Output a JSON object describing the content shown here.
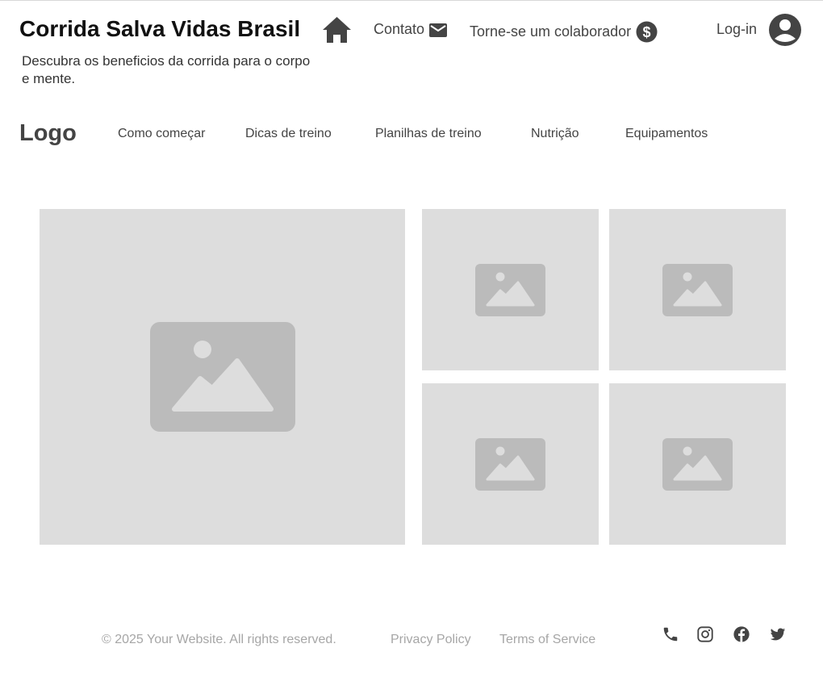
{
  "header": {
    "site_title": "Corrida Salva Vidas Brasil",
    "tagline": "Descubra os beneficios da corrida para o corpo e mente.",
    "home_icon": "home-icon",
    "links": {
      "contact": "Contato",
      "contributor": "Torne-se um colaborador"
    },
    "login": "Log-in"
  },
  "nav": {
    "logo": "Logo",
    "items": [
      "Como começar",
      "Dicas de treino",
      "Planilhas de treino",
      "Nutrição",
      "Equipamentos"
    ]
  },
  "gallery": {
    "placeholder_icon": "image-placeholder-icon",
    "tiles": 5
  },
  "footer": {
    "copyright": "© 2025 Your Website. All rights reserved.",
    "privacy": "Privacy Policy",
    "terms": "Terms of Service",
    "social_icons": [
      "phone-icon",
      "instagram-icon",
      "facebook-icon",
      "twitter-icon"
    ]
  },
  "colors": {
    "text_dark": "#111111",
    "text": "#444444",
    "icon": "#444444",
    "tile_bg": "#dddddd",
    "placeholder": "#bbbbbb",
    "footer_text": "#a6a6a6"
  }
}
